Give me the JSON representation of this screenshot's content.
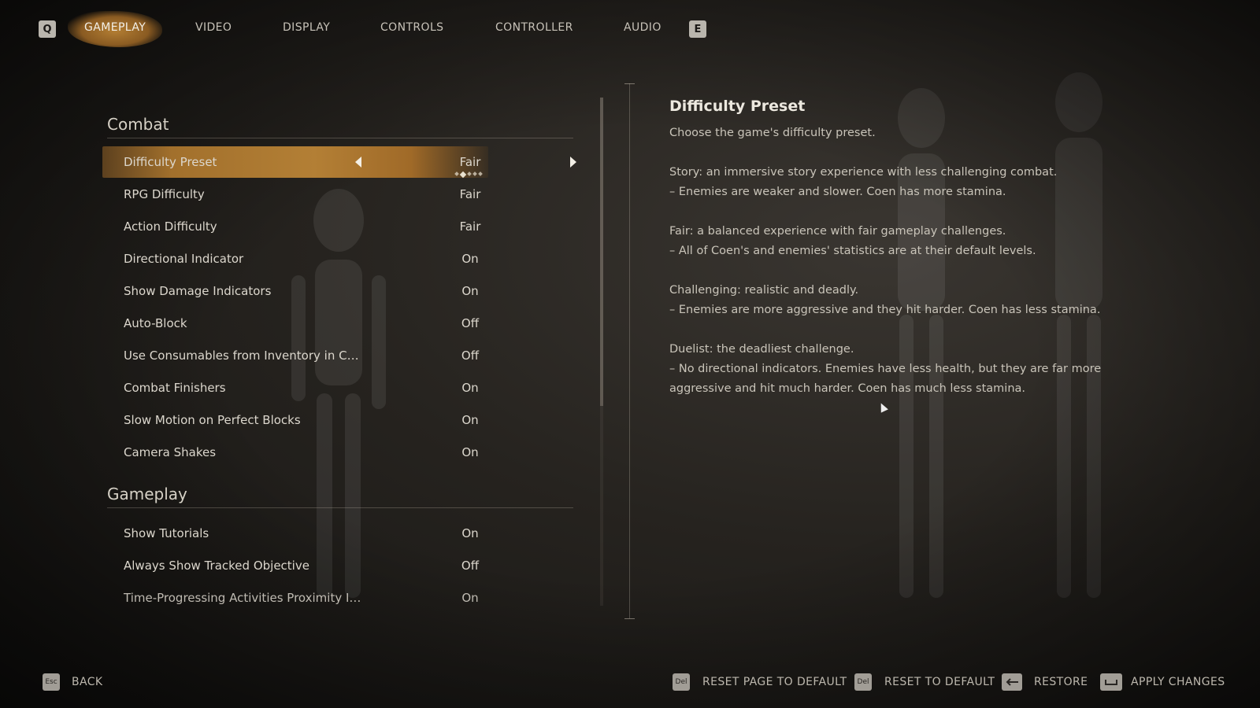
{
  "nav": {
    "left_key": "Q",
    "right_key": "E",
    "tabs": [
      "GAMEPLAY",
      "VIDEO",
      "DISPLAY",
      "CONTROLS",
      "CONTROLLER",
      "AUDIO"
    ],
    "active_tab": "GAMEPLAY"
  },
  "sections": [
    {
      "title": "Combat",
      "rows": [
        {
          "label": "Difficulty Preset",
          "value": "Fair",
          "selected": true
        },
        {
          "label": "RPG Difficulty",
          "value": "Fair"
        },
        {
          "label": "Action Difficulty",
          "value": "Fair"
        },
        {
          "label": "Directional Indicator",
          "value": "On"
        },
        {
          "label": "Show Damage Indicators",
          "value": "On"
        },
        {
          "label": "Auto-Block",
          "value": "Off"
        },
        {
          "label": "Use Consumables from Inventory in C…",
          "value": "Off"
        },
        {
          "label": "Combat Finishers",
          "value": "On"
        },
        {
          "label": "Slow Motion on Perfect Blocks",
          "value": "On"
        },
        {
          "label": "Camera Shakes",
          "value": "On"
        }
      ]
    },
    {
      "title": "Gameplay",
      "rows": [
        {
          "label": "Show Tutorials",
          "value": "On"
        },
        {
          "label": "Always Show Tracked Objective",
          "value": "Off"
        },
        {
          "label": "Time-Progressing Activities Proximity I…",
          "value": "On"
        }
      ]
    }
  ],
  "description": {
    "title": "Difficulty Preset",
    "intro": "Choose the game's difficulty preset.",
    "story": [
      "Story: an immersive story experience with less challenging combat.",
      "– Enemies are weaker and slower. Coen has more stamina."
    ],
    "fair": [
      "Fair: a balanced experience with fair gameplay challenges.",
      "– All of Coen's and enemies' statistics are at their default levels."
    ],
    "challenging": [
      "Challenging: realistic and deadly.",
      "– Enemies are more aggressive and they hit harder. Coen has less stamina."
    ],
    "duelist": [
      "Duelist: the deadliest challenge.",
      "– No directional indicators. Enemies have less health, but they are far more",
      "aggressive and hit much harder. Coen has much less stamina."
    ]
  },
  "bottom": {
    "back_key": "Esc",
    "back_label": "BACK",
    "reset_page_key": "Del",
    "reset_page_label": "RESET PAGE TO DEFAULT",
    "reset_key": "Del",
    "reset_label": "RESET TO DEFAULT",
    "restore_label": "RESTORE",
    "apply_label": "APPLY CHANGES"
  },
  "colors": {
    "accent": "#b37f35",
    "text": "#dcd7cd",
    "background": "#26231f"
  }
}
